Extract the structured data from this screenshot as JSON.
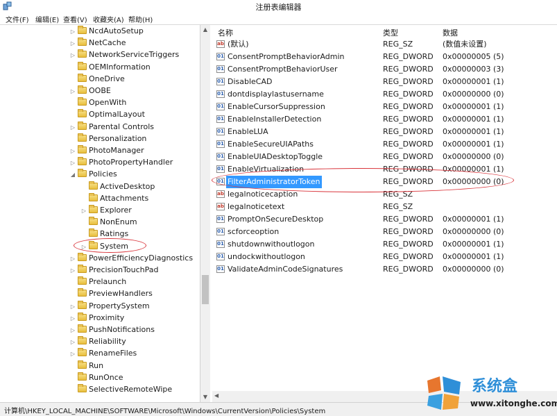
{
  "window": {
    "title": "注册表编辑器"
  },
  "menu": [
    "文件(F)",
    "编辑(E)",
    "查看(V)",
    "收藏夹(A)",
    "帮助(H)"
  ],
  "tree": [
    {
      "label": "NcdAutoSetup",
      "expander": "▷"
    },
    {
      "label": "NetCache",
      "expander": "▷"
    },
    {
      "label": "NetworkServiceTriggers",
      "expander": "▷"
    },
    {
      "label": "OEMInformation",
      "expander": ""
    },
    {
      "label": "OneDrive",
      "expander": ""
    },
    {
      "label": "OOBE",
      "expander": "▷"
    },
    {
      "label": "OpenWith",
      "expander": ""
    },
    {
      "label": "OptimalLayout",
      "expander": ""
    },
    {
      "label": "Parental Controls",
      "expander": "▷"
    },
    {
      "label": "Personalization",
      "expander": ""
    },
    {
      "label": "PhotoManager",
      "expander": "▷"
    },
    {
      "label": "PhotoPropertyHandler",
      "expander": "▷"
    },
    {
      "label": "Policies",
      "expander": "◢"
    },
    {
      "label": "ActiveDesktop",
      "expander": ""
    },
    {
      "label": "Attachments",
      "expander": ""
    },
    {
      "label": "Explorer",
      "expander": "▷"
    },
    {
      "label": "NonEnum",
      "expander": ""
    },
    {
      "label": "Ratings",
      "expander": ""
    },
    {
      "label": "System",
      "expander": "▷"
    },
    {
      "label": "PowerEfficiencyDiagnostics",
      "expander": "▷"
    },
    {
      "label": "PrecisionTouchPad",
      "expander": "▷"
    },
    {
      "label": "Prelaunch",
      "expander": ""
    },
    {
      "label": "PreviewHandlers",
      "expander": ""
    },
    {
      "label": "PropertySystem",
      "expander": "▷"
    },
    {
      "label": "Proximity",
      "expander": "▷"
    },
    {
      "label": "PushNotifications",
      "expander": "▷"
    },
    {
      "label": "Reliability",
      "expander": "▷"
    },
    {
      "label": "RenameFiles",
      "expander": "▷"
    },
    {
      "label": "Run",
      "expander": ""
    },
    {
      "label": "RunOnce",
      "expander": ""
    },
    {
      "label": "SelectiveRemoteWipe",
      "expander": ""
    }
  ],
  "list": {
    "columns": {
      "name": "名称",
      "type": "类型",
      "data": "数据"
    },
    "rows": [
      {
        "name": "(默认)",
        "type": "REG_SZ",
        "data": "(数值未设置)",
        "icon": "string-value-icon",
        "badge": "ab"
      },
      {
        "name": "ConsentPromptBehaviorAdmin",
        "type": "REG_DWORD",
        "data": "0x00000005 (5)",
        "icon": "dword-value-icon",
        "badge": "01"
      },
      {
        "name": "ConsentPromptBehaviorUser",
        "type": "REG_DWORD",
        "data": "0x00000003 (3)",
        "icon": "dword-value-icon",
        "badge": "01"
      },
      {
        "name": "DisableCAD",
        "type": "REG_DWORD",
        "data": "0x00000001 (1)",
        "icon": "dword-value-icon",
        "badge": "01"
      },
      {
        "name": "dontdisplaylastusername",
        "type": "REG_DWORD",
        "data": "0x00000000 (0)",
        "icon": "dword-value-icon",
        "badge": "01"
      },
      {
        "name": "EnableCursorSuppression",
        "type": "REG_DWORD",
        "data": "0x00000001 (1)",
        "icon": "dword-value-icon",
        "badge": "01"
      },
      {
        "name": "EnableInstallerDetection",
        "type": "REG_DWORD",
        "data": "0x00000001 (1)",
        "icon": "dword-value-icon",
        "badge": "01"
      },
      {
        "name": "EnableLUA",
        "type": "REG_DWORD",
        "data": "0x00000001 (1)",
        "icon": "dword-value-icon",
        "badge": "01"
      },
      {
        "name": "EnableSecureUIAPaths",
        "type": "REG_DWORD",
        "data": "0x00000001 (1)",
        "icon": "dword-value-icon",
        "badge": "01"
      },
      {
        "name": "EnableUIADesktopToggle",
        "type": "REG_DWORD",
        "data": "0x00000000 (0)",
        "icon": "dword-value-icon",
        "badge": "01"
      },
      {
        "name": "EnableVirtualization",
        "type": "REG_DWORD",
        "data": "0x00000001 (1)",
        "icon": "dword-value-icon",
        "badge": "01"
      },
      {
        "name": "FilterAdministratorToken",
        "type": "REG_DWORD",
        "data": "0x00000000 (0)",
        "icon": "dword-value-icon",
        "badge": "01",
        "selected": true
      },
      {
        "name": "legalnoticecaption",
        "type": "REG_SZ",
        "data": "",
        "icon": "string-value-icon",
        "badge": "ab"
      },
      {
        "name": "legalnoticetext",
        "type": "REG_SZ",
        "data": "",
        "icon": "string-value-icon",
        "badge": "ab"
      },
      {
        "name": "PromptOnSecureDesktop",
        "type": "REG_DWORD",
        "data": "0x00000001 (1)",
        "icon": "dword-value-icon",
        "badge": "01"
      },
      {
        "name": "scforceoption",
        "type": "REG_DWORD",
        "data": "0x00000000 (0)",
        "icon": "dword-value-icon",
        "badge": "01"
      },
      {
        "name": "shutdownwithoutlogon",
        "type": "REG_DWORD",
        "data": "0x00000001 (1)",
        "icon": "dword-value-icon",
        "badge": "01"
      },
      {
        "name": "undockwithoutlogon",
        "type": "REG_DWORD",
        "data": "0x00000001 (1)",
        "icon": "dword-value-icon",
        "badge": "01"
      },
      {
        "name": "ValidateAdminCodeSignatures",
        "type": "REG_DWORD",
        "data": "0x00000000 (0)",
        "icon": "dword-value-icon",
        "badge": "01"
      }
    ]
  },
  "status": {
    "path": "计算机\\HKEY_LOCAL_MACHINE\\SOFTWARE\\Microsoft\\Windows\\CurrentVersion\\Policies\\System"
  },
  "watermark": {
    "name": "系统盒",
    "url": "www.xitonghe.com"
  },
  "colors": {
    "selection": "#3399ff",
    "annotation": "#d9343a"
  }
}
